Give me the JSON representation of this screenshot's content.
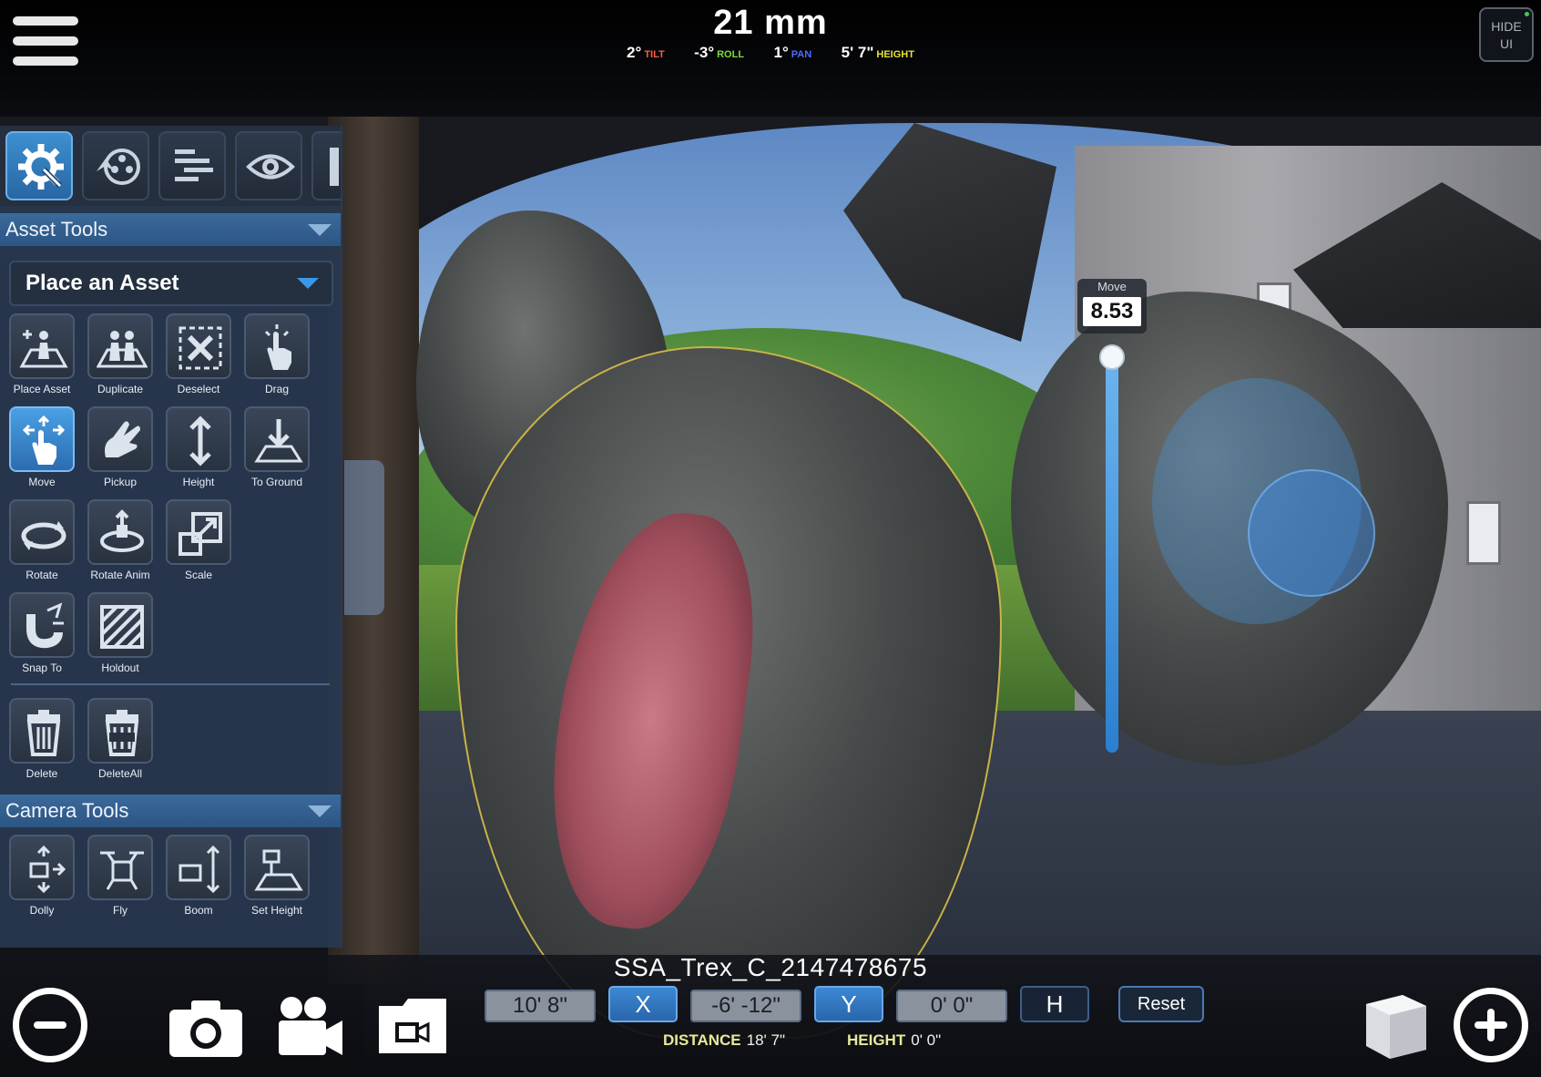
{
  "topbar": {
    "lens": "21 mm",
    "stats": [
      {
        "value": "2°",
        "label": "TILT",
        "color": "#ff5a4a"
      },
      {
        "value": "-3°",
        "label": "ROLL",
        "color": "#7ddc3a"
      },
      {
        "value": "1°",
        "label": "PAN",
        "color": "#4b6cff"
      },
      {
        "value": "5' 7\"",
        "label": "HEIGHT",
        "color": "#e8e03a"
      }
    ],
    "hide_ui_line1": "HIDE",
    "hide_ui_line2": "UI",
    "menu_icon": "hamburger-menu-icon"
  },
  "panel": {
    "tabs": [
      {
        "name": "tools-tab",
        "icon": "gear-icon",
        "active": true
      },
      {
        "name": "assets-tab",
        "icon": "film-reel-icon",
        "active": false
      },
      {
        "name": "align-tab",
        "icon": "align-lines-icon",
        "active": false
      },
      {
        "name": "view-tab",
        "icon": "eye-icon",
        "active": false
      }
    ],
    "asset_tools_header": "Asset Tools",
    "dropdown_value": "Place an Asset",
    "asset_tools": [
      {
        "label": "Place Asset",
        "icon": "place-asset-icon",
        "active": false
      },
      {
        "label": "Duplicate",
        "icon": "duplicate-icon",
        "active": false
      },
      {
        "label": "Deselect",
        "icon": "deselect-icon",
        "active": false
      },
      {
        "label": "Drag",
        "icon": "drag-hand-icon",
        "active": false
      },
      {
        "label": "Move",
        "icon": "move-icon",
        "active": true
      },
      {
        "label": "Pickup",
        "icon": "pickup-hand-icon",
        "active": false
      },
      {
        "label": "Height",
        "icon": "height-arrows-icon",
        "active": false
      },
      {
        "label": "To Ground",
        "icon": "to-ground-icon",
        "active": false
      },
      {
        "label": "Rotate",
        "icon": "rotate-icon",
        "active": false
      },
      {
        "label": "Rotate Anim",
        "icon": "rotate-anim-icon",
        "active": false
      },
      {
        "label": "Scale",
        "icon": "scale-icon",
        "active": false
      },
      {
        "label": "Snap To",
        "icon": "magnet-icon",
        "active": false
      },
      {
        "label": "Holdout",
        "icon": "holdout-icon",
        "active": false
      },
      {
        "label": "Delete",
        "icon": "trash-icon",
        "active": false
      },
      {
        "label": "DeleteAll",
        "icon": "trash-all-icon",
        "active": false
      }
    ],
    "camera_tools_header": "Camera Tools",
    "camera_tools": [
      {
        "label": "Dolly",
        "icon": "dolly-icon"
      },
      {
        "label": "Fly",
        "icon": "drone-icon"
      },
      {
        "label": "Boom",
        "icon": "boom-icon"
      },
      {
        "label": "Set Height",
        "icon": "set-height-icon"
      }
    ]
  },
  "gizmo": {
    "label": "Move",
    "value": "8.53"
  },
  "bottom": {
    "asset_name": "SSA_Trex_C_2147478675",
    "x_field": "10' 8\"",
    "x_label": "X",
    "y_field": "-6' -12\"",
    "y_label": "Y",
    "h_field": "0' 0\"",
    "h_label": "H",
    "reset": "Reset",
    "distance_label": "DISTANCE",
    "distance_value": "18' 7\"",
    "height_label": "HEIGHT",
    "height_value": "0' 0\"",
    "icons": [
      "remove-circle-icon",
      "camera-icon",
      "video-camera-icon",
      "folder-video-icon",
      "cube-icon",
      "add-circle-icon"
    ]
  }
}
